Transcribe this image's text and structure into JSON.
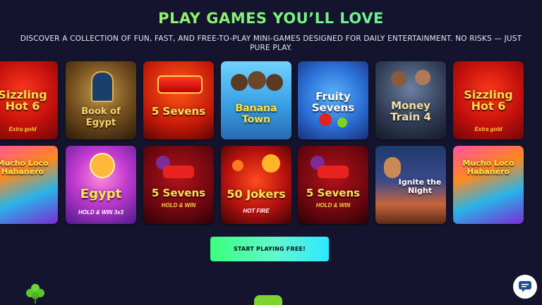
{
  "section": {
    "title": "PLAY GAMES YOU’LL LOVE",
    "subtitle": "DISCOVER A COLLECTION OF FUN, FAST, AND FREE-TO-PLAY MINI-GAMES DESIGNED FOR DAILY ENTERTAINMENT. NO RISKS — JUST PURE PLAY."
  },
  "games": {
    "row1": [
      {
        "name": "Sizzling Hot 6",
        "sub": "Extra gold"
      },
      {
        "name": "Book of Egypt",
        "sub": ""
      },
      {
        "name": "5 Sevens",
        "sub": ""
      },
      {
        "name": "Banana Town",
        "sub": ""
      },
      {
        "name": "Fruity Sevens",
        "sub": ""
      },
      {
        "name": "Money Train 4",
        "sub": ""
      },
      {
        "name": "Sizzling Hot 6",
        "sub": "Extra gold"
      }
    ],
    "row2": [
      {
        "name": "Mucho Loco Habanero",
        "sub": ""
      },
      {
        "name": "Egypt",
        "sub": "HOLD & WIN 3x3"
      },
      {
        "name": "5 Sevens",
        "sub": "HOLD & WIN"
      },
      {
        "name": "50 Jokers",
        "sub": "HOT FIRE"
      },
      {
        "name": "5 Sevens",
        "sub": "HOLD & WIN"
      },
      {
        "name": "Ignite the Night",
        "sub": ""
      },
      {
        "name": "Mucho Loco Habanero",
        "sub": ""
      }
    ]
  },
  "cta": {
    "label": "START PLAYING FREE!"
  },
  "icons": {
    "clover": "clover-icon",
    "chat": "chat-bubble-icon"
  },
  "colors": {
    "background": "#14142e",
    "title_gradient_start": "#b6f04a",
    "title_gradient_end": "#4ff0b8",
    "cta_start": "#39ff7e",
    "cta_end": "#2ee8ff"
  }
}
